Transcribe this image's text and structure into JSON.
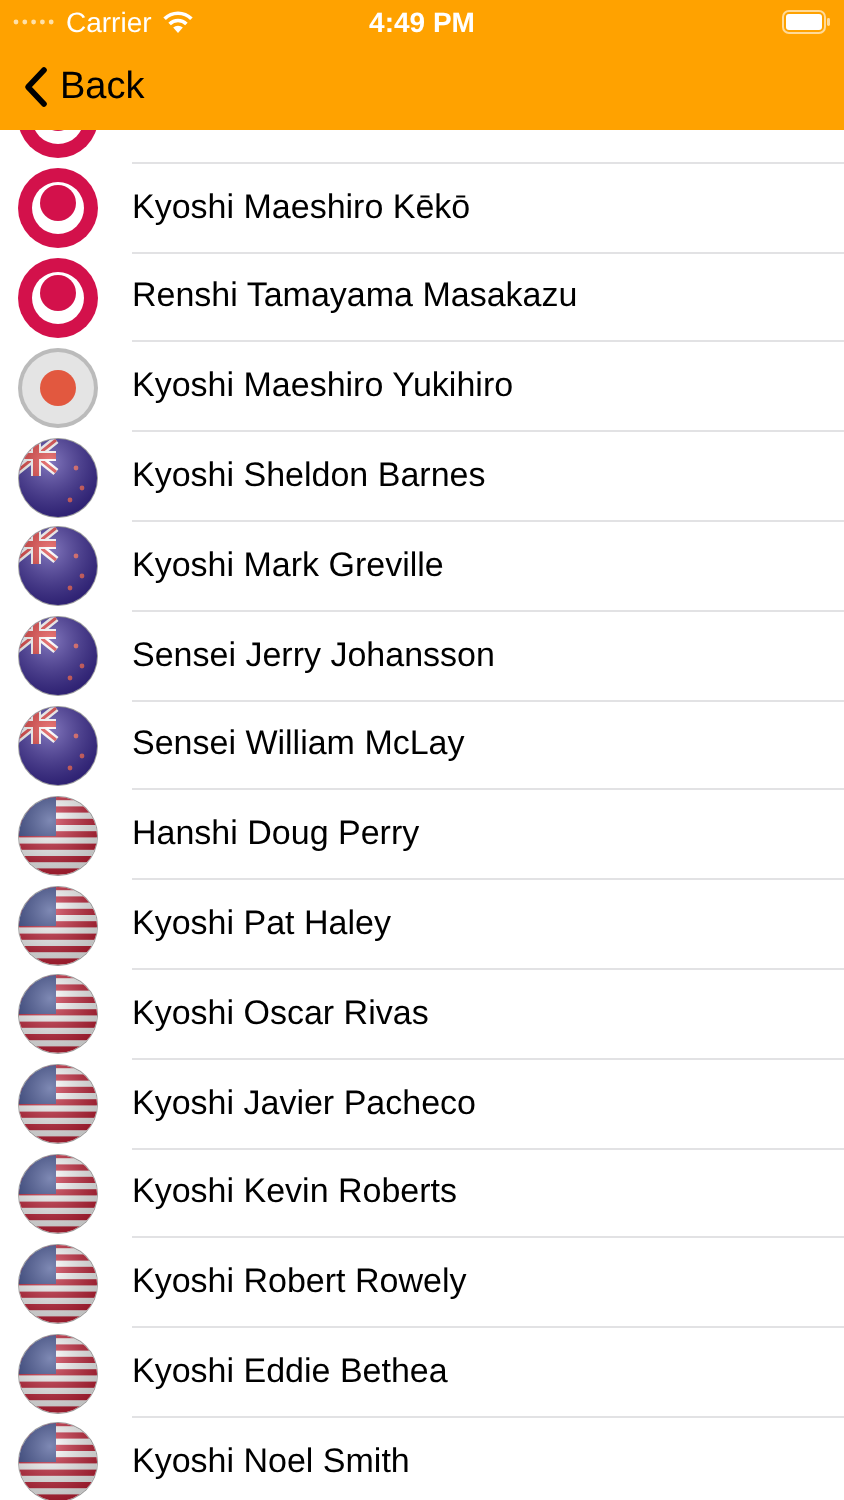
{
  "status_bar": {
    "carrier": "Carrier",
    "time": "4:49 PM"
  },
  "nav": {
    "back": "Back"
  },
  "rows": [
    {
      "kind": "okinawa"
    },
    {
      "kind": "okinawa",
      "name": "Kyoshi Maeshiro Kēkō"
    },
    {
      "kind": "okinawa",
      "name": "Renshi Tamayama Masakazu"
    },
    {
      "kind": "japan",
      "name": "Kyoshi Maeshiro Yukihiro"
    },
    {
      "kind": "nz",
      "name": "Kyoshi Sheldon Barnes"
    },
    {
      "kind": "nz",
      "name": "Kyoshi Mark Greville"
    },
    {
      "kind": "nz",
      "name": "Sensei Jerry Johansson"
    },
    {
      "kind": "nz",
      "name": "Sensei William McLay"
    },
    {
      "kind": "usa",
      "name": "Hanshi Doug Perry"
    },
    {
      "kind": "usa",
      "name": "Kyoshi Pat Haley"
    },
    {
      "kind": "usa",
      "name": "Kyoshi Oscar Rivas"
    },
    {
      "kind": "usa",
      "name": "Kyoshi Javier Pacheco"
    },
    {
      "kind": "usa",
      "name": "Kyoshi Kevin Roberts"
    },
    {
      "kind": "usa",
      "name": "Kyoshi Robert Rowely"
    },
    {
      "kind": "usa",
      "name": "Kyoshi Eddie Bethea"
    },
    {
      "kind": "usa",
      "name": "Kyoshi Noel Smith"
    }
  ]
}
